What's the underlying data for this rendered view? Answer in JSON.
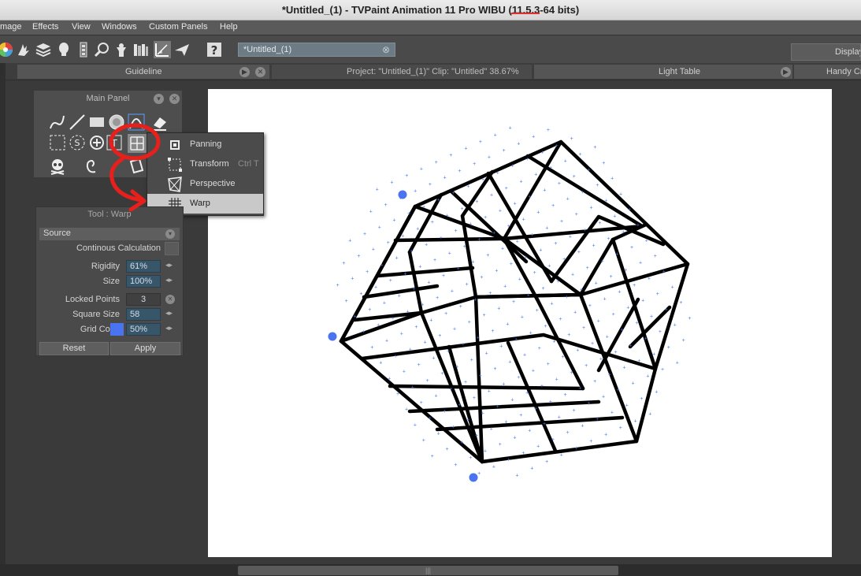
{
  "window": {
    "title_before": "*Untitled_(1) - TVPaint Animation 11 Pro WIBU (",
    "title_version": "11.5.3",
    "title_after": "-64 bits)"
  },
  "menu": {
    "items": [
      "mage",
      "Effects",
      "View",
      "Windows",
      "Custom Panels",
      "Help"
    ]
  },
  "toolbar": {
    "document_tab": "*Untitled_(1)",
    "display_label": "Display",
    "icons": [
      "color-wheel-icon",
      "hand-icon",
      "layers-icon",
      "lightbulb-icon",
      "mixer-icon",
      "magnifier-icon",
      "character-icon",
      "bookshelf-icon",
      "warp-grid-icon",
      "paper-plane-icon",
      "help-icon"
    ]
  },
  "panel_headers": {
    "guideline": "Guideline",
    "project": "Project:  \"Untitled_(1)\"  Clip: \"Untitled\"   38.67%",
    "light_table": "Light Table",
    "handy": "Handy Cr"
  },
  "main_panel": {
    "title": "Main Panel",
    "tools": [
      "freehand-icon",
      "line-icon",
      "rectangle-icon",
      "circle-icon",
      "bezier-icon",
      "eraser-icon",
      "select-rect-icon",
      "select-lasso-icon",
      "zoom-add-icon",
      "text-icon",
      "warp-tool-icon",
      "skull-icon",
      "spiral-icon",
      "brush-icon",
      "page-icon"
    ]
  },
  "flyout": {
    "items": [
      {
        "label": "Panning",
        "shortcut": "",
        "checked": false
      },
      {
        "label": "Transform",
        "shortcut": "Ctrl T",
        "checked": false
      },
      {
        "label": "Perspective",
        "shortcut": "",
        "checked": false
      },
      {
        "label": "Warp",
        "shortcut": "",
        "checked": true
      }
    ],
    "check_glyph": "✓"
  },
  "warp_panel": {
    "title": "Tool : Warp",
    "source_label": "Source",
    "continous_label": "Continous Calculation",
    "rigidity_label": "Rigidity",
    "rigidity_value": "61%",
    "size_label": "Size",
    "size_value": "100%",
    "locked_label": "Locked Points",
    "locked_value": "3",
    "square_label": "Square Size",
    "square_value": "58",
    "grid_color_label": "Grid Color",
    "grid_color_value": "50%",
    "grid_color_hex": "#4a73f0",
    "reset_label": "Reset",
    "apply_label": "Apply"
  },
  "colors": {
    "annotation_red": "#e8201c",
    "handle_blue": "#4a73f0",
    "active_item": "#c9c9c9"
  }
}
